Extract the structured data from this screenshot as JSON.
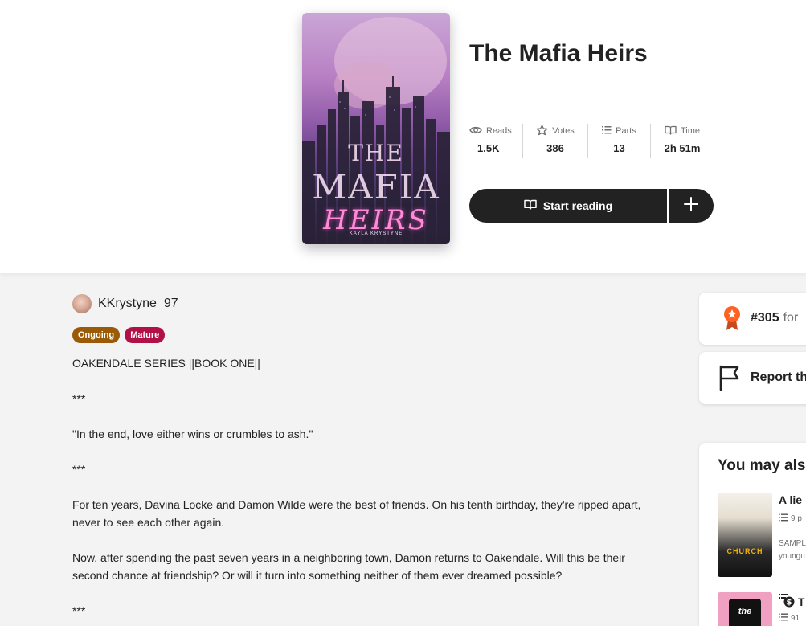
{
  "story": {
    "title": "The Mafia Heirs",
    "cover": {
      "line1": "THE",
      "line2": "MAFIA",
      "line3": "HEIRS",
      "author": "KAYLA KRYSTYNE"
    },
    "stats": {
      "reads": {
        "label": "Reads",
        "value": "1.5K",
        "icon": "eye-icon"
      },
      "votes": {
        "label": "Votes",
        "value": "386",
        "icon": "star-icon"
      },
      "parts": {
        "label": "Parts",
        "value": "13",
        "icon": "list-icon"
      },
      "time": {
        "label": "Time",
        "value": "2h 51m",
        "icon": "book-icon"
      }
    },
    "actions": {
      "start_reading": "Start reading",
      "add_icon": "plus-icon"
    },
    "author": "KKrystyne_97",
    "tags": {
      "ongoing": "Ongoing",
      "mature": "Mature"
    },
    "description": {
      "p1": "OAKENDALE SERIES ||BOOK ONE||",
      "p2": "***",
      "p3": "\"In the end, love either wins or crumbles to ash.\"",
      "p4": "***",
      "p5": "For ten years, Davina Locke and Damon Wilde were the best of friends. On his tenth birthday, they're ripped apart, never to see each other again.",
      "p6": "Now, after spending the past seven years in a neighboring town, Damon returns to Oakendale. Will this be their second chance at friendship? Or will it turn into something neither of them ever dreamed possible?",
      "p7": "***"
    }
  },
  "sidebar": {
    "rank": {
      "number": "#305",
      "suffix": "for"
    },
    "report": {
      "label": "Report th"
    },
    "also_like": {
      "heading": "You may als",
      "books": [
        {
          "title": "A lie",
          "parts": "9 p",
          "desc_line1": "SAMPL",
          "desc_line2": "youngu",
          "cover_text": "CHURCH"
        },
        {
          "title": "T",
          "parts": "91",
          "cover_text": "the"
        }
      ]
    }
  },
  "colors": {
    "dark_button": "#222222",
    "ongoing": "#9a5a06",
    "mature": "#b21147",
    "rank_accent": "#ff6122"
  }
}
